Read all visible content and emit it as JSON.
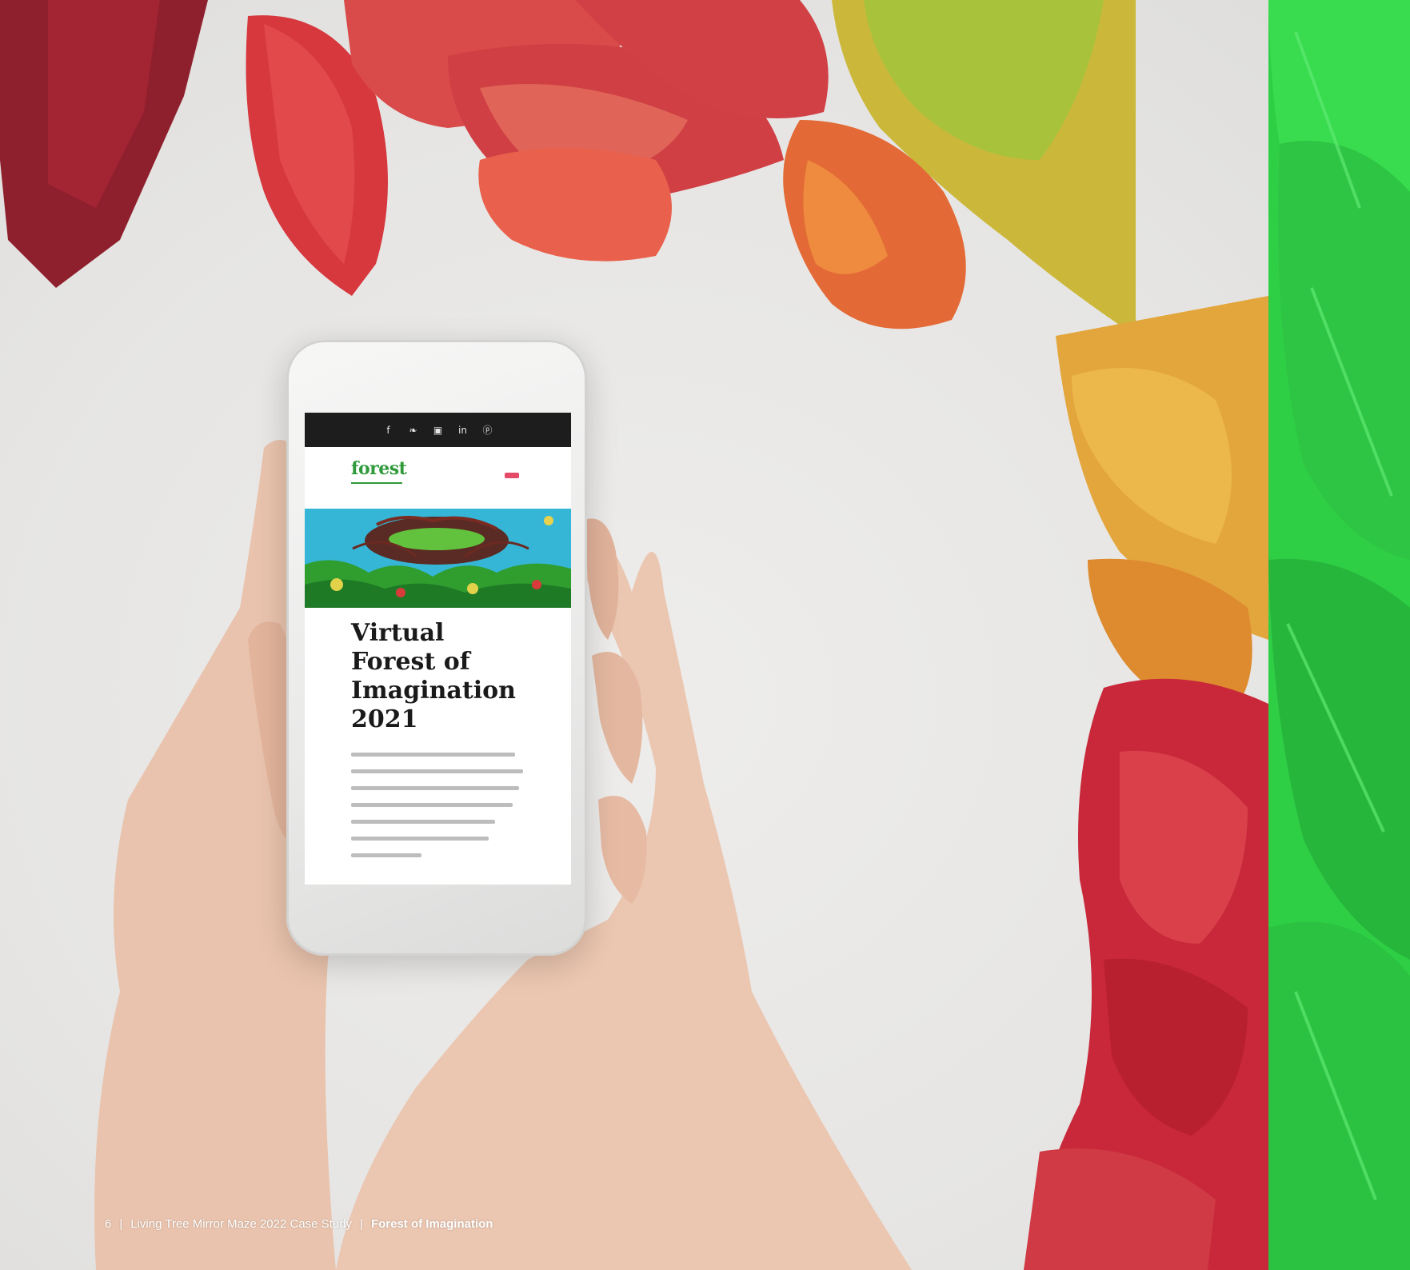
{
  "colors": {
    "accent_green": "#2fcf45",
    "brand_green": "#2f9a3a",
    "menu_pink": "#e54a66",
    "social_bar": "#1d1d1d"
  },
  "phone_screen": {
    "social_icons": [
      {
        "name": "facebook-icon",
        "glyph": "f"
      },
      {
        "name": "twitter-icon",
        "glyph": "❧"
      },
      {
        "name": "instagram-icon",
        "glyph": "▣"
      },
      {
        "name": "linkedin-icon",
        "glyph": "in"
      },
      {
        "name": "pinterest-icon",
        "glyph": "ⓟ"
      }
    ],
    "logo_text": "forest",
    "article_title": "Virtual\nForest of\nImagination\n2021"
  },
  "footer": {
    "page_number": "6",
    "separator": "|",
    "document_title": "Living Tree Mirror Maze 2022 Case Study",
    "section_title": "Forest of Imagination"
  }
}
